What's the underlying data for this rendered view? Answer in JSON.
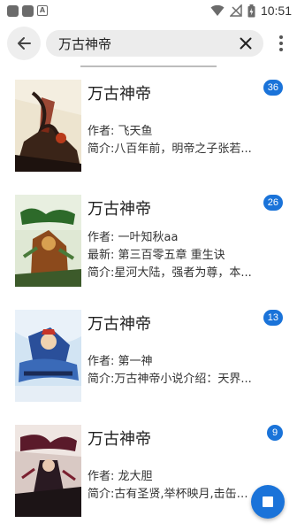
{
  "status_bar": {
    "time": "10:51",
    "notif_letter": "A",
    "icons": [
      "app-notification-icon",
      "app-notification-icon",
      "a-notification-icon",
      "wifi-icon",
      "no-signal-icon",
      "battery-icon"
    ]
  },
  "search": {
    "query": "万古神帝",
    "back_icon": "arrow-back-icon",
    "clear_icon": "close-icon",
    "more_icon": "more-vert-icon"
  },
  "books": [
    {
      "title": "万古神帝",
      "author": "作者: 飞天鱼",
      "latest": "",
      "intro": "简介:八百年前，明帝之子张若...",
      "count": "36",
      "cover_colors": [
        "#e7dcc4",
        "#8b2a16",
        "#2a1a14"
      ]
    },
    {
      "title": "万古神帝",
      "author": "作者: 一叶知秋aa",
      "latest": "最新: 第三百零五章 重生诀",
      "intro": "简介:星河大陆，强者为尊，本...",
      "count": "26",
      "cover_colors": [
        "#dfe8d4",
        "#2d6a2a",
        "#8c4a1c"
      ]
    },
    {
      "title": "万古神帝",
      "author": "作者: 第一神",
      "latest": "",
      "intro": "简介:万古神帝小说介绍：天界...",
      "count": "13",
      "cover_colors": [
        "#cfe2f2",
        "#2a4f9a",
        "#c7352a"
      ]
    },
    {
      "title": "万古神帝",
      "author": "作者: 龙大胆",
      "latest": "",
      "intro": "简介:古有圣贤,举杯映月,击缶而...",
      "count": "9",
      "cover_colors": [
        "#d9c9c4",
        "#5a1a2a",
        "#1c1416"
      ]
    }
  ],
  "fab": {
    "icon": "stop-icon"
  },
  "colors": {
    "accent": "#1a73d9",
    "search_bg": "#ececec"
  }
}
